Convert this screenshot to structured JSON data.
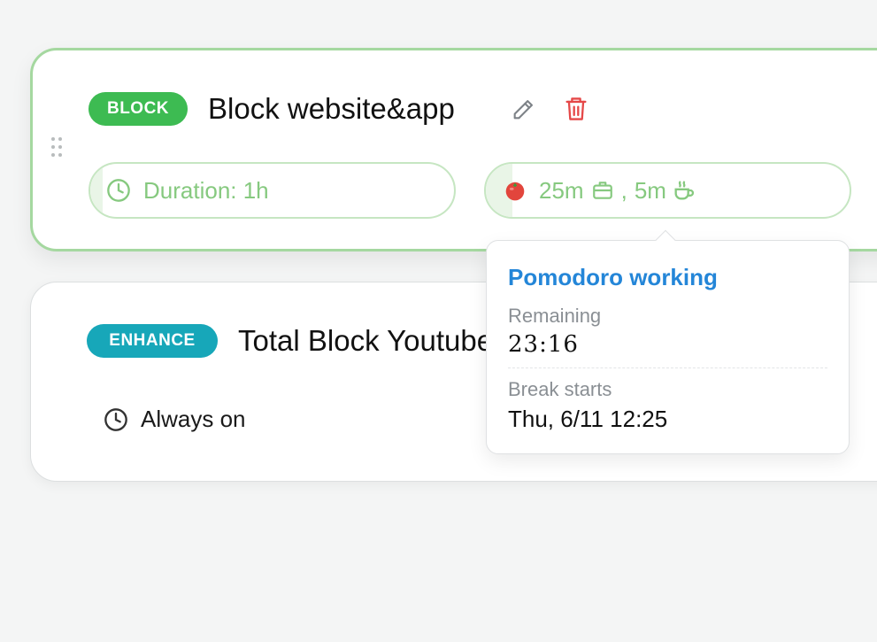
{
  "rules": [
    {
      "badge": "BLOCK",
      "title": "Block website&app",
      "duration": "Duration: 1h",
      "pomodoro": {
        "work": "25m",
        "separator": ",",
        "break": "5m"
      },
      "icons": [
        "drag-handle-icon",
        "pencil-icon",
        "trash-icon",
        "clock-icon",
        "tomato-icon",
        "briefcase-icon",
        "coffee-icon"
      ]
    },
    {
      "badge": "ENHANCE",
      "title": "Total Block Youtube",
      "schedule": "Always on",
      "icons": [
        "clock-icon"
      ]
    }
  ],
  "tooltip": {
    "title": "Pomodoro working",
    "remaining_label": "Remaining",
    "remaining_value": "23:16",
    "break_label": "Break starts",
    "break_value": "Thu, 6/11 12:25"
  },
  "colors": {
    "block_badge": "#3dbb52",
    "enhance_badge": "#17a7b9",
    "active_border": "#a5d8a0",
    "pill_text": "#86c97f",
    "tooltip_title": "#2486d8",
    "delete": "#e54848",
    "background": "#f4f5f5"
  }
}
